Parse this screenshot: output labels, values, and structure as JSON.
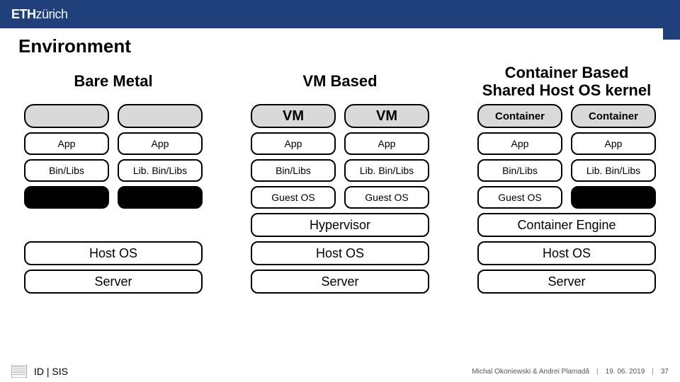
{
  "brand": {
    "bold": "ETH",
    "light": "zürich"
  },
  "title": "Environment",
  "columns": [
    {
      "heading": "Bare Metal",
      "unit_label_left": "",
      "unit_label_right": "",
      "unit_label_size": "sm",
      "left": {
        "app": "App",
        "libs": "Bin/Libs",
        "guest": ""
      },
      "right": {
        "app": "App",
        "libs": "Lib. Bin/Libs",
        "guest": ""
      },
      "show_guest_row": true,
      "left_guest_empty": true,
      "right_guest_empty": true,
      "hypervisor": "",
      "show_hypervisor": false,
      "host": "Host OS",
      "server": "Server"
    },
    {
      "heading": "VM Based",
      "unit_label_left": "VM",
      "unit_label_right": "VM",
      "unit_label_size": "lg",
      "left": {
        "app": "App",
        "libs": "Bin/Libs",
        "guest": "Guest OS"
      },
      "right": {
        "app": "App",
        "libs": "Lib. Bin/Libs",
        "guest": "Guest OS"
      },
      "show_guest_row": true,
      "left_guest_empty": false,
      "right_guest_empty": false,
      "hypervisor": "Hypervisor",
      "show_hypervisor": true,
      "host": "Host OS",
      "server": "Server"
    },
    {
      "heading": "Container Based\nShared Host OS kernel",
      "unit_label_left": "Container",
      "unit_label_right": "Container",
      "unit_label_size": "sm",
      "left": {
        "app": "App",
        "libs": "Bin/Libs",
        "guest": "Guest OS"
      },
      "right": {
        "app": "App",
        "libs": "Lib. Bin/Libs",
        "guest": ""
      },
      "show_guest_row": true,
      "left_guest_empty": false,
      "right_guest_empty": true,
      "hypervisor": "Container Engine",
      "show_hypervisor": true,
      "host": "Host OS",
      "server": "Server"
    }
  ],
  "footer": {
    "left": "ID | SIS",
    "authors": "Michal Okoniewski & Andrei Plamadă",
    "date": "19. 06. 2019",
    "page": "37"
  }
}
